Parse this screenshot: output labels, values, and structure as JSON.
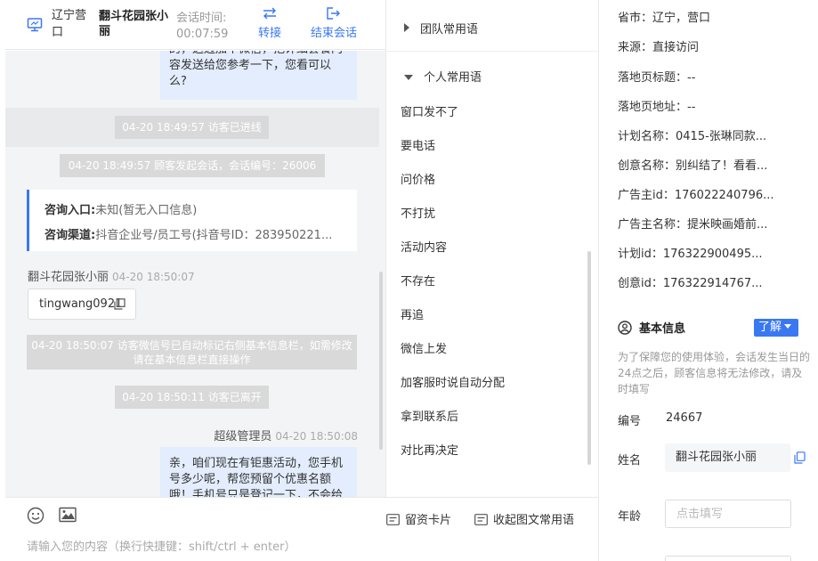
{
  "header": {
    "region": "辽宁营口",
    "visitor_name": "翻斗花园张小丽",
    "session_time_label": "会话时间:",
    "session_time": "00:07:59",
    "transfer_label": "转接",
    "end_label": "结束会话"
  },
  "chat": {
    "msg_top": "的，这边加个微信，把详细套餐内容发送给您参考一下，您看可以么?",
    "sys_entered": "04-20 18:49:57 访客已进线",
    "sys_started": "04-20 18:49:57 顾客发起会话，会话编号：26006",
    "entry_label": "咨询入口:",
    "entry_value": "未知(暂无入口信息)",
    "channel_label": "咨询渠道:",
    "channel_value": "抖音企业号/员工号(抖音号ID：283950221...",
    "visitor_sender": "翻斗花园张小丽",
    "visitor_time": "04-20 18:50:07",
    "wechat_id": "tingwang0921",
    "sys_wechat": "04-20 18:50:07 访客微信号已自动标记右侧基本信息栏，如需修改请在基本信息栏直接操作",
    "sys_left": "04-20 18:50:11 访客已离开",
    "agent_sender": "超级管理员",
    "agent_time": "04-20 18:50:08",
    "msg_bottom": "亲，咱们现在有钜惠活动，您手机号多少呢，帮您预留个优惠名额哦！手机号只是登记一下，不会给"
  },
  "input": {
    "card_label": "留资卡片",
    "phrases_toggle_label": "收起图文常用语",
    "placeholder": "请输入您的内容（换行快捷键：shift/ctrl + enter）"
  },
  "phrases": {
    "team_group": "团队常用语",
    "personal_group": "个人常用语",
    "items": [
      "窗口发不了",
      "要电话",
      "问价格",
      "不打扰",
      "活动内容",
      "不存在",
      "再追",
      "微信上发",
      "加客服时说自动分配",
      "拿到联系后",
      "对比再决定"
    ]
  },
  "info": {
    "province": "省市：辽宁，营口",
    "source": "来源：直接访问",
    "landing_title": "落地页标题：--",
    "landing_url": "落地页地址：--",
    "plan_name": "计划名称：0415-张琳同款...",
    "creative_name": "创意名称：别纠结了！看看...",
    "advertiser_id": "广告主id：176022240796...",
    "advertiser_name": "广告主名称：提米映画婚前...",
    "plan_id": "计划id：176322900495...",
    "creative_id": "创意id：176322914767...",
    "basic_title": "基本信息",
    "learn_label": "了解",
    "notice": "为了保障您的使用体验，会话发生当日的24点之后，顾客信息将无法修改，请及时填写",
    "id_label": "编号",
    "id_value": "24667",
    "name_label": "姓名",
    "name_value": "翻斗花园张小丽",
    "age_label": "年龄",
    "age_placeholder": "点击填写"
  },
  "colors": {
    "accent": "#3a78f2",
    "bubble": "#e3edfd",
    "system": "#d9d9d9"
  }
}
